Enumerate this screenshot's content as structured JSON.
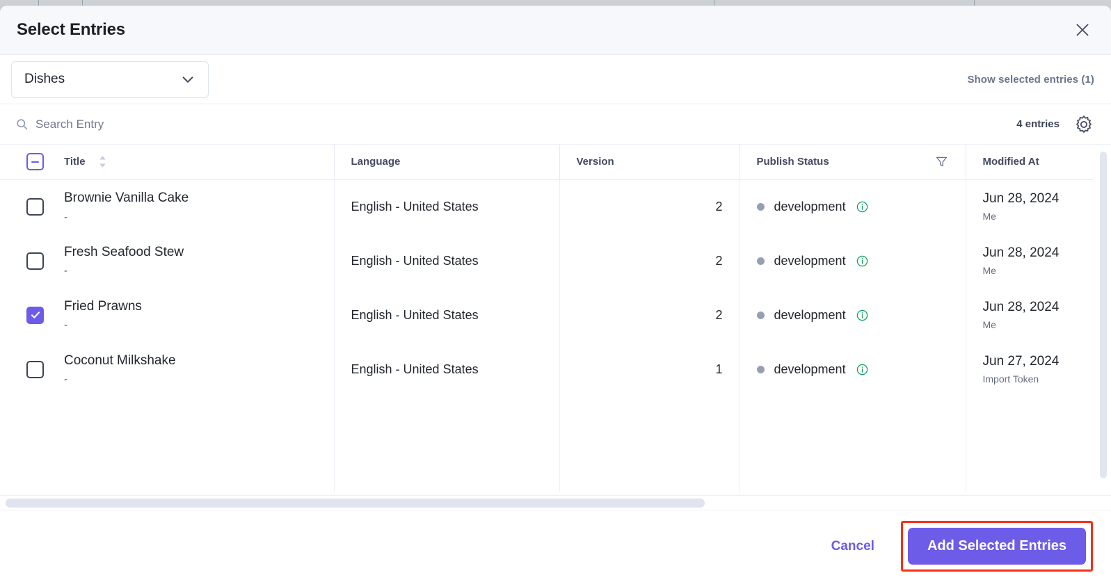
{
  "modal": {
    "title": "Select Entries",
    "close_icon": "close-icon"
  },
  "toolbar": {
    "content_type": "Dishes",
    "chevron_icon": "chevron-down-icon",
    "show_selected_label": "Show selected entries (1)",
    "search_placeholder": "Search Entry",
    "search_value": "",
    "search_icon": "search-icon",
    "entries_count_label": "4 entries",
    "settings_icon": "gear-icon"
  },
  "table": {
    "columns": [
      {
        "key": "select",
        "label": "",
        "align": "left"
      },
      {
        "key": "title",
        "label": "Title",
        "align": "left",
        "sort_icon": "sort-updown-icon"
      },
      {
        "key": "language",
        "label": "Language",
        "align": "left"
      },
      {
        "key": "version",
        "label": "Version",
        "align": "right"
      },
      {
        "key": "publish_status",
        "label": "Publish Status",
        "align": "left",
        "filter_icon": "filter-icon"
      },
      {
        "key": "modified_at",
        "label": "Modified At",
        "align": "left"
      }
    ],
    "header_checkbox_state": "indeterminate",
    "rows": [
      {
        "selected": false,
        "title": "Brownie Vanilla Cake",
        "subtitle": "-",
        "language": "English - United States",
        "version": "2",
        "status": "development",
        "status_info_icon": "info-circle-icon",
        "modified_date": "Jun 28, 2024",
        "modified_by": "Me"
      },
      {
        "selected": false,
        "title": "Fresh Seafood Stew",
        "subtitle": "-",
        "language": "English - United States",
        "version": "2",
        "status": "development",
        "status_info_icon": "info-circle-icon",
        "modified_date": "Jun 28, 2024",
        "modified_by": "Me"
      },
      {
        "selected": true,
        "title": "Fried Prawns",
        "subtitle": "-",
        "language": "English - United States",
        "version": "2",
        "status": "development",
        "status_info_icon": "info-circle-icon",
        "modified_date": "Jun 28, 2024",
        "modified_by": "Me"
      },
      {
        "selected": false,
        "title": "Coconut Milkshake",
        "subtitle": "-",
        "language": "English - United States",
        "version": "1",
        "status": "development",
        "status_info_icon": "info-circle-icon",
        "modified_date": "Jun 27, 2024",
        "modified_by": "Import Token"
      }
    ]
  },
  "footer": {
    "cancel_label": "Cancel",
    "primary_label": "Add Selected Entries"
  },
  "colors": {
    "accent": "#6c5ce8",
    "header_bg": "#f7f8fc",
    "status_dot": "#96a0b5",
    "info_green": "#12a05c",
    "highlight_red": "#fa2e13",
    "link_gray": "#6b7590"
  }
}
